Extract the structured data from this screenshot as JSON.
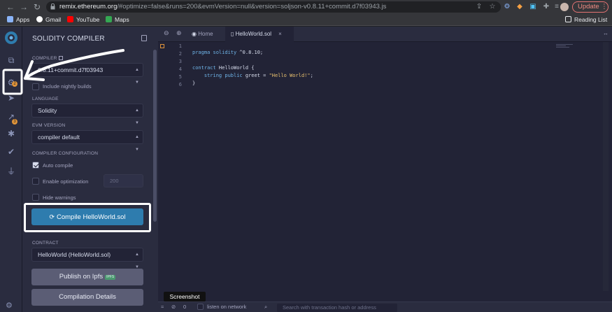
{
  "browser": {
    "url_host": "remix.ethereum.org",
    "url_rest": "/#optimize=false&runs=200&evmVersion=null&version=soljson-v0.8.11+commit.d7f03943.js",
    "update_label": "Update",
    "bookmarks": [
      {
        "label": "Apps",
        "color": "#8ab4f8"
      },
      {
        "label": "Gmail",
        "color": "#ea4335"
      },
      {
        "label": "YouTube",
        "color": "#ff0000"
      },
      {
        "label": "Maps",
        "color": "#34a853"
      }
    ],
    "reading_list": "Reading List"
  },
  "panel": {
    "title": "SOLIDITY COMPILER",
    "compiler_label": "COMPILER",
    "compiler_value": "0.8.11+commit.d7f03943",
    "include_nightly": "Include nightly builds",
    "language_label": "LANGUAGE",
    "language_value": "Solidity",
    "evm_label": "EVM VERSION",
    "evm_value": "compiler default",
    "config_label": "COMPILER CONFIGURATION",
    "auto_compile": "Auto compile",
    "enable_optimization": "Enable optimization",
    "runs_value": "200",
    "hide_warnings": "Hide warnings",
    "compile_button": "Compile HelloWorld.sol",
    "contract_label": "CONTRACT",
    "contract_value": "HelloWorld (HelloWorld.sol)",
    "publish_button": "Publish on Ipfs",
    "ipfs_tag": "IPFS",
    "details_button": "Compilation Details"
  },
  "iconbar": {
    "badge_compiler": "2",
    "badge_analysis": "3"
  },
  "editor": {
    "tabs": [
      {
        "label": "Home",
        "icon": "remix-home-icon"
      },
      {
        "label": "HelloWorld.sol",
        "icon": "file-icon"
      }
    ],
    "line_numbers": [
      "1",
      "2",
      "3",
      "4",
      "5",
      "6"
    ],
    "code": {
      "line2_kw": "pragma solidity",
      "line2_rest": " ^0.8.10;",
      "line4_kw": "contract",
      "line4_rest": " HelloWorld {",
      "line5_kw": "    string public",
      "line5_mid": " greet = ",
      "line5_str": "\"Hello World!\"",
      "line5_end": ";",
      "line6": "}"
    }
  },
  "terminal": {
    "tooltip": "Screenshot",
    "count": "0",
    "listen_label": "listen on network",
    "search_placeholder": "Search with transaction hash or address"
  },
  "colors": {
    "accent": "#2e7cae",
    "badge": "#e0943a",
    "annotation": "#ffffff"
  }
}
